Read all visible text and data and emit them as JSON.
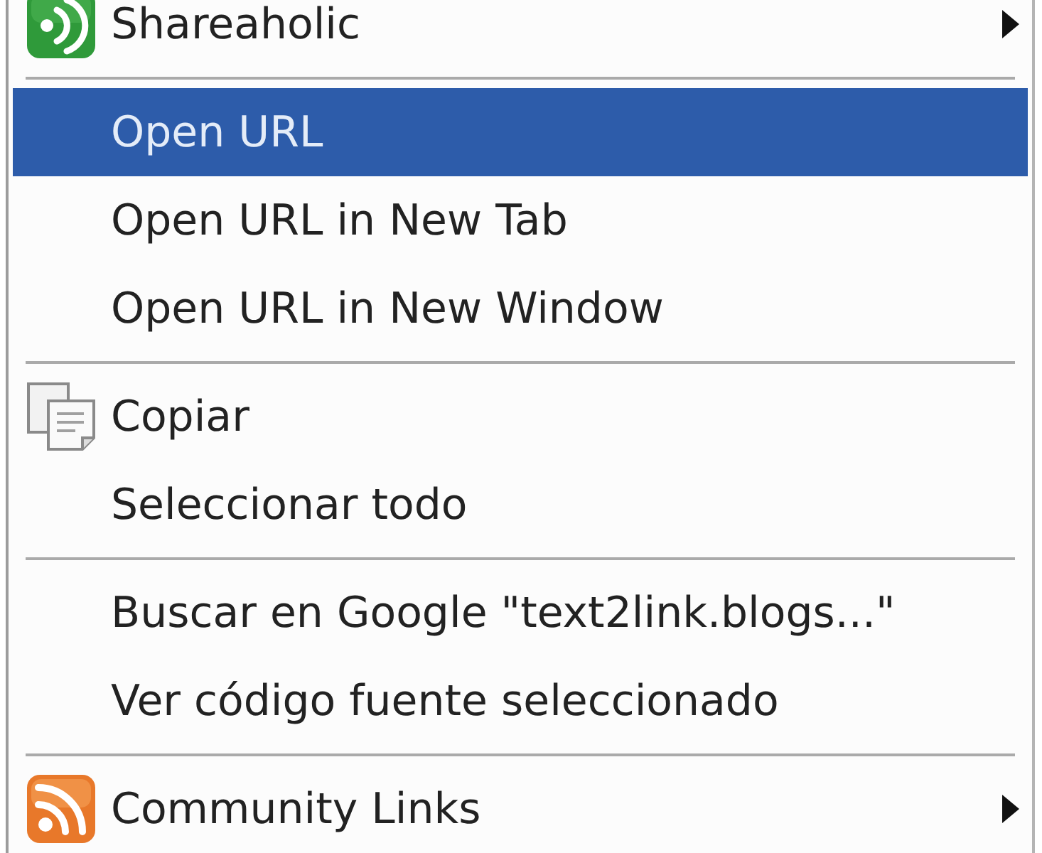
{
  "menu": {
    "items": [
      {
        "kind": "item",
        "label": "Shareaholic",
        "submenu": true,
        "selected": false
      },
      {
        "kind": "separator"
      },
      {
        "kind": "item",
        "label": "Open URL",
        "submenu": false,
        "selected": true
      },
      {
        "kind": "item",
        "label": "Open URL in New Tab",
        "submenu": false,
        "selected": false
      },
      {
        "kind": "item",
        "label": "Open URL in New Window",
        "submenu": false,
        "selected": false
      },
      {
        "kind": "separator"
      },
      {
        "kind": "item",
        "label": "Copiar",
        "submenu": false,
        "selected": false
      },
      {
        "kind": "item",
        "label": "Seleccionar todo",
        "submenu": false,
        "selected": false
      },
      {
        "kind": "separator"
      },
      {
        "kind": "item",
        "label": "Buscar en Google \"text2link.blogs...\"",
        "submenu": false,
        "selected": false
      },
      {
        "kind": "item",
        "label": "Ver código fuente seleccionado",
        "submenu": false,
        "selected": false
      },
      {
        "kind": "separator"
      },
      {
        "kind": "item",
        "label": "Community Links",
        "submenu": true,
        "selected": false
      }
    ]
  }
}
